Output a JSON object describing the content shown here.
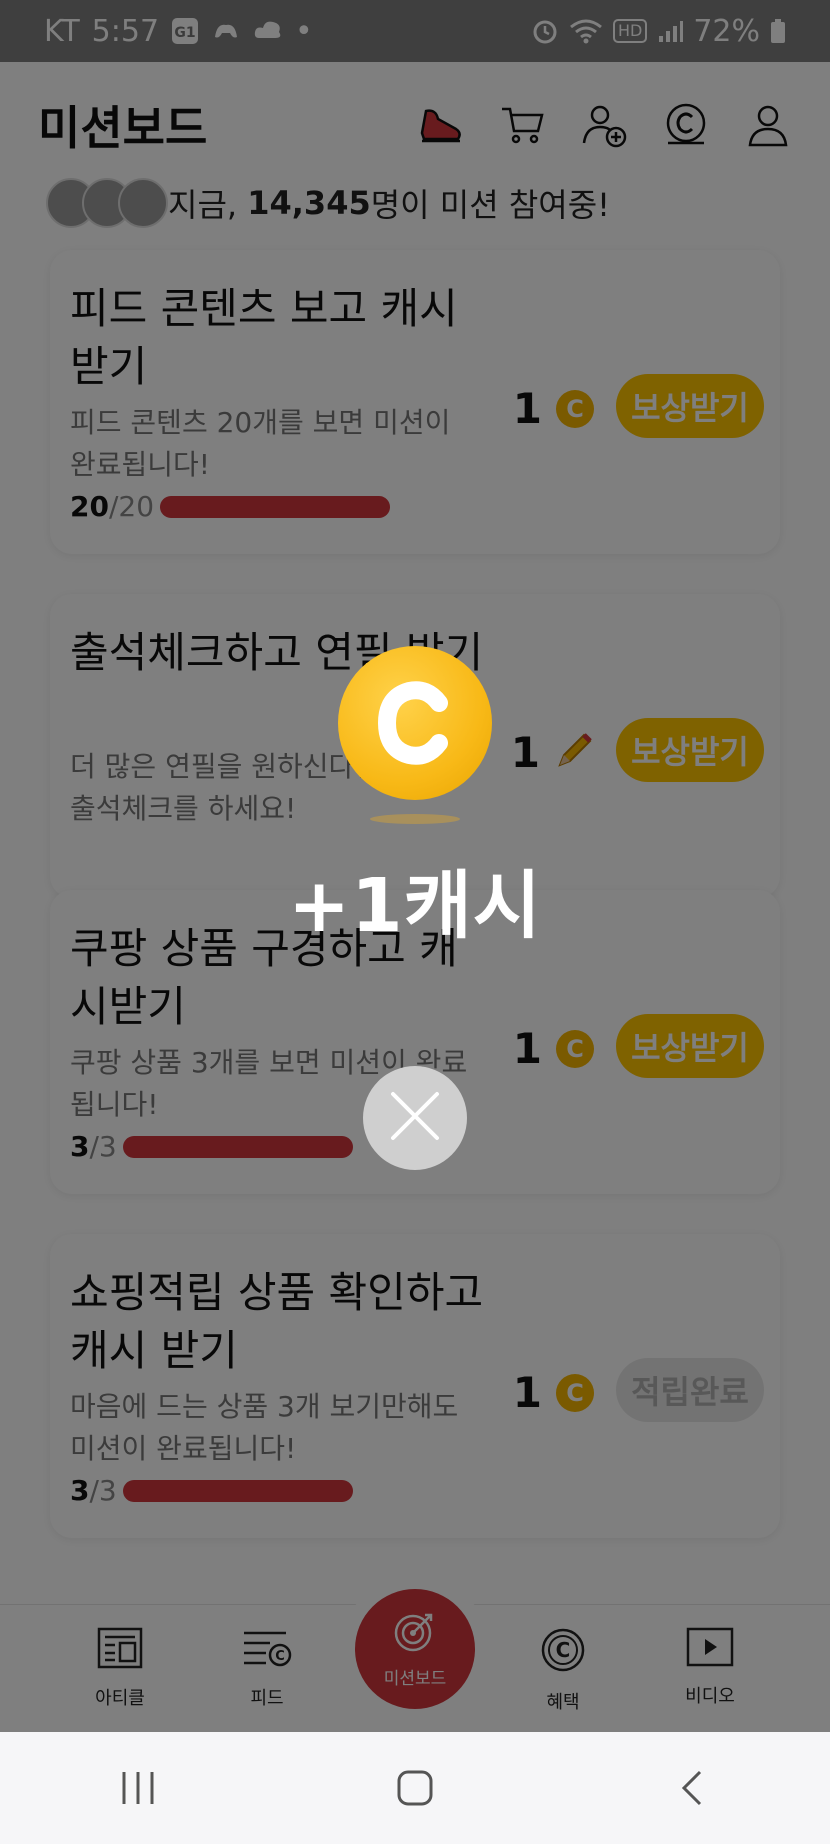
{
  "status_bar": {
    "carrier": "KT",
    "time": "5:57",
    "left_icons": [
      "g1-icon",
      "game-controller-icon",
      "cloud-icon"
    ],
    "dot": "•",
    "hd_badge": "HD",
    "battery": "72%"
  },
  "header": {
    "title": "미션보드",
    "icons": [
      "sneaker-icon",
      "cart-icon",
      "add-friend-icon",
      "cash-coin-icon",
      "profile-icon"
    ]
  },
  "participants": {
    "prefix": "지금,",
    "count": "14,345",
    "suffix": "명이 미션 참여중!"
  },
  "missions": [
    {
      "title": "피드 콘텐츠 보고 캐시 받기",
      "description": "피드 콘텐츠 20개를 보면 미션이 완료됩니다!",
      "progress_current": "20",
      "progress_total": "/20",
      "reward_amount": "1",
      "reward_icon": "cash-coin-icon",
      "button_label": "보상받기",
      "button_state": "active"
    },
    {
      "title": "출석체크하고 연필 받기",
      "description": "더 많은 연필을 원하신다면 바로 출석체크를 하세요!",
      "progress_current": "",
      "progress_total": "",
      "reward_amount": "1",
      "reward_icon": "pencil-icon",
      "button_label": "보상받기",
      "button_state": "active"
    },
    {
      "title": "쿠팡 상품 구경하고 캐시받기",
      "description": "쿠팡 상품 3개를 보면 미션이 완료됩니다!",
      "progress_current": "3",
      "progress_total": "/3",
      "reward_amount": "1",
      "reward_icon": "cash-coin-icon",
      "button_label": "보상받기",
      "button_state": "active"
    },
    {
      "title": "쇼핑적립 상품 확인하고 캐시 받기",
      "description": "마음에 드는 상품 3개 보기만해도 미션이 완료됩니다!",
      "progress_current": "3",
      "progress_total": "/3",
      "reward_amount": "1",
      "reward_icon": "cash-coin-icon",
      "button_label": "적립완료",
      "button_state": "done"
    }
  ],
  "bottom_nav": {
    "items": [
      {
        "label": "아티클",
        "icon": "article-icon"
      },
      {
        "label": "피드",
        "icon": "feed-icon"
      },
      {
        "label": "미션보드",
        "icon": "target-icon"
      },
      {
        "label": "혜택",
        "icon": "cash-coin-icon"
      },
      {
        "label": "비디오",
        "icon": "play-icon"
      }
    ]
  },
  "popup": {
    "coin_icon": "cash-coin-icon",
    "reward_text": "+1캐시",
    "close_icon": "close-icon"
  },
  "colors": {
    "accent_red": "#d1373d",
    "reward_yellow": "#ffc400",
    "coin_gold": "#f8b917",
    "overlay": "rgba(0,0,0,0.5)"
  }
}
